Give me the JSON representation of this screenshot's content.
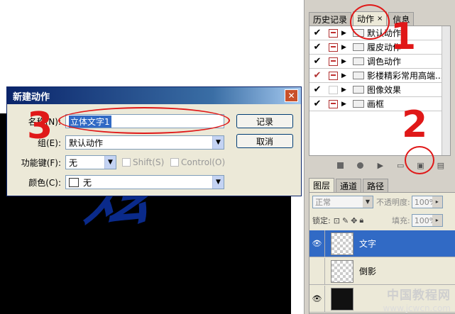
{
  "canvas": {
    "art_text": "炫"
  },
  "actions_panel": {
    "tabs": [
      {
        "label": "历史记录",
        "active": false
      },
      {
        "label": "动作",
        "active": true,
        "close": "×"
      },
      {
        "label": "信息",
        "active": false
      }
    ],
    "rows": [
      {
        "label": "默认动作",
        "checked": "✔",
        "dialog_on": true
      },
      {
        "label": "履皮动作",
        "checked": "✔",
        "dialog_on": true
      },
      {
        "label": "调色动作",
        "checked": "✔",
        "dialog_on": true
      },
      {
        "label": "影楼精彩常用高端...",
        "checked": "✔",
        "dialog_on": true
      },
      {
        "label": "图像效果",
        "checked": "✔",
        "dialog_on": false
      },
      {
        "label": "画框",
        "checked": "✔",
        "dialog_on": true
      }
    ]
  },
  "layers_panel": {
    "tabs": [
      {
        "label": "图层",
        "active": true
      },
      {
        "label": "通道",
        "active": false
      },
      {
        "label": "路径",
        "active": false
      }
    ],
    "blend_mode": "正常",
    "opacity_label": "不透明度:",
    "opacity_value": "100%",
    "lock_label": "锁定:",
    "fill_label": "填充:",
    "fill_value": "100%",
    "layers": [
      {
        "name": "文字",
        "visible": true,
        "selected": true
      },
      {
        "name": "倒影",
        "visible": false,
        "selected": false
      },
      {
        "name": "",
        "visible": true,
        "selected": false
      }
    ]
  },
  "dialog": {
    "title": "新建动作",
    "close": "✕",
    "name_label": "名称(N):",
    "name_value": "立体文字1",
    "set_label": "组(E):",
    "set_value": "默认动作",
    "fkey_label": "功能键(F):",
    "fkey_value": "无",
    "shift_label": "Shift(S)",
    "control_label": "Control(O)",
    "color_label": "颜色(C):",
    "color_value": "无",
    "record_button": "记录",
    "cancel_button": "取消"
  },
  "annotations": {
    "one": "1",
    "two": "2",
    "three": "3",
    "color": "#e01818"
  },
  "watermark": {
    "line1": "中国教程网",
    "line2": "www.jcwcn.com"
  }
}
